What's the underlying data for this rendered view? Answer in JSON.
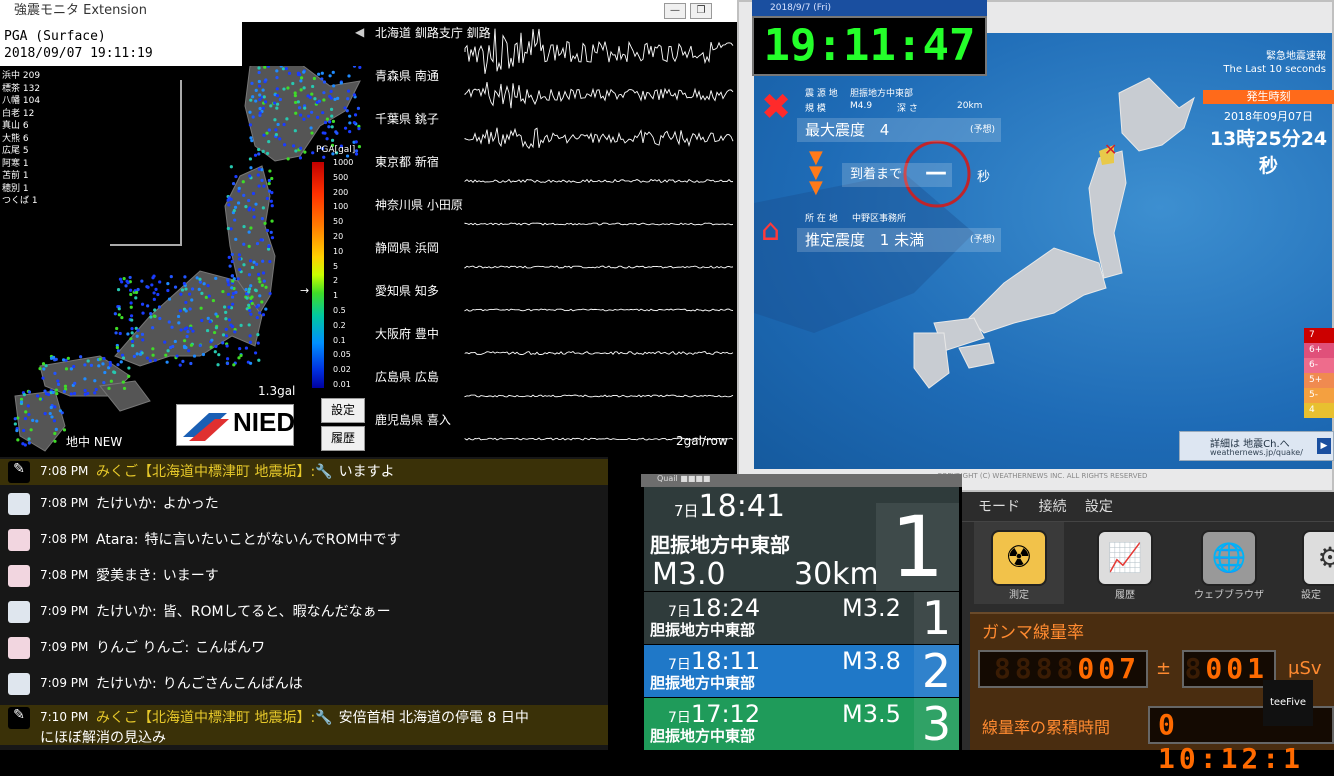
{
  "kyoshin": {
    "window_title": "強震モニタ Extension",
    "pga_title": "PGA (Surface)",
    "pga_datetime": "2018/09/07 19:11:19",
    "sites": [
      "浜中 209",
      "標茶 132",
      "八幡 104",
      "白老 12",
      "真山 6",
      "大熊 6",
      "広尾 5",
      "阿寒 1",
      "苫前 1",
      "穂別 1",
      "つくば 1"
    ],
    "scale_title": "PGA[gal]",
    "scale_ticks": [
      "1000",
      "500",
      "200",
      "100",
      "50",
      "20",
      "10",
      "5",
      "2",
      "1",
      "0.5",
      "0.2",
      "0.1",
      "0.05",
      "0.02",
      "0.01"
    ],
    "current_gal": "1.3gal",
    "logo": "NIED",
    "ground_label": "地中 NEW",
    "settings_button": "設定",
    "history_button": "履歴",
    "stations": [
      "北海道 釧路支庁 釧路",
      "青森県 南通",
      "千葉県 銚子",
      "東京都 新宿",
      "神奈川県 小田原",
      "静岡県 浜岡",
      "愛知県 知多",
      "大阪府 豊中",
      "広島県 広島",
      "鹿児島県 喜入"
    ],
    "gal_per_row": "2gal/row",
    "minimize": "—",
    "restore": "❐"
  },
  "weathernews": {
    "clock_title": "2018/9/7 (Fri)",
    "clock": "19:11:47",
    "header_title": "緊急地震速報",
    "header_sub": "The Last 10 seconds",
    "epicenter_label": "震 源 地",
    "epicenter": "胆振地方中東部",
    "scale_label": "規 模",
    "magnitude": "M4.9",
    "depth_label": "深 さ",
    "depth": "20km",
    "max_intensity_label": "最大震度",
    "max_intensity": "4",
    "forecast_note": "(予想)",
    "arrival_label": "到着まで",
    "arrival_value": "—",
    "arrival_unit": "秒",
    "location_label": "所 在 地",
    "location": "中野区事務所",
    "est_intensity_label": "推定震度",
    "est_intensity": "1 未満",
    "occur_label": "発生時刻",
    "occur_date": "2018年09月07日",
    "occur_time": "13時25分24秒",
    "intensity_levels": [
      "7",
      "6+",
      "6-",
      "5+",
      "5-",
      "4"
    ],
    "link_text": "詳細は 地震Ch.へ",
    "link_url": "weathernews.jp/quake/",
    "copyright": "COPYRIGHT (C) WEATHERNEWS INC. ALL RIGHTS RESERVED",
    "colors": {
      "max": "#ff2a2a",
      "panel": "#ff6a1a",
      "sea": "#1e6bb6",
      "clock": "#24ff2a"
    }
  },
  "chat": [
    {
      "time": "7:08 PM",
      "name": "みくご【北海道中標津町 地震垢】:🔧",
      "msg": "いますよ",
      "highlight": true,
      "icon": "pen-icon"
    },
    {
      "time": "7:08 PM",
      "name": "たけいか:",
      "msg": "よかった",
      "highlight": false,
      "icon": "document-icon"
    },
    {
      "time": "7:08 PM",
      "name": "Atara:",
      "msg": "特に言いたいことがないんでROM中です",
      "highlight": false,
      "icon": "avatar-icon"
    },
    {
      "time": "7:08 PM",
      "name": "愛美まき:",
      "msg": "いまーす",
      "highlight": false,
      "icon": "avatar-icon"
    },
    {
      "time": "7:09 PM",
      "name": "たけいか:",
      "msg": "皆、ROMしてると、暇なんだなぁー",
      "highlight": false,
      "icon": "document-icon"
    },
    {
      "time": "7:09 PM",
      "name": "りんご りんご:",
      "msg": "こんばんワ",
      "highlight": false,
      "icon": "avatar-icon"
    },
    {
      "time": "7:09 PM",
      "name": "たけいか:",
      "msg": "りんごさんこんばんは",
      "highlight": false,
      "icon": "document-icon"
    },
    {
      "time": "7:10 PM",
      "name": "みくご【北海道中標津町 地震垢】:🔧",
      "msg": "安倍首相 北海道の停電 8 日中",
      "msg2": "にほぼ解消の見込み",
      "highlight": true,
      "icon": "pen-icon"
    }
  ],
  "quake_list": {
    "title": "Quail ■■■■",
    "main": {
      "day": "7日",
      "time": "18:41",
      "loc": "胆振地方中東部",
      "mag": "M3.0",
      "depth": "30km",
      "rank": "1"
    },
    "rows": [
      {
        "day": "7日",
        "time": "18:24",
        "loc": "胆振地方中東部",
        "mag": "M3.2",
        "rank": "1",
        "color": "#2f3b3b"
      },
      {
        "day": "7日",
        "time": "18:11",
        "loc": "胆振地方中東部",
        "mag": "M3.8",
        "rank": "2",
        "color": "#1f78c8"
      },
      {
        "day": "7日",
        "time": "17:12",
        "loc": "胆振地方中東部",
        "mag": "M3.5",
        "rank": "3",
        "color": "#1f9b5a"
      }
    ]
  },
  "gamma": {
    "menu": [
      "モード",
      "接続",
      "設定"
    ],
    "tools": [
      "測定",
      "履歴",
      "ウェブブラウザ",
      "設定"
    ],
    "panel_title": "ガンマ線量率",
    "value1": "007",
    "value2": "001",
    "plusminus": "±",
    "unit": "μSv",
    "cumulative_label": "線量率の累積時間",
    "cumulative": "0 10:12:1"
  },
  "watermark": "teeFive"
}
